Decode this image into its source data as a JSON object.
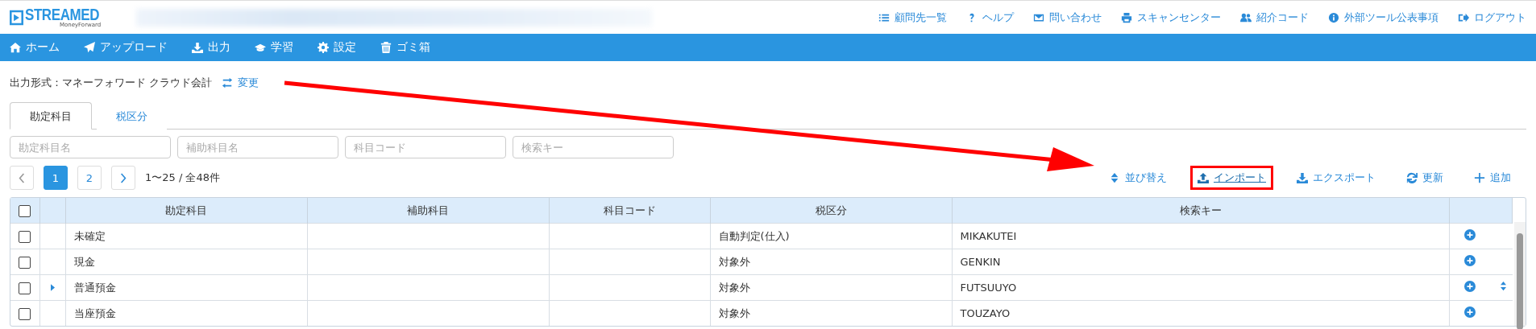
{
  "header": {
    "logo": {
      "name": "STREAMED",
      "tagline": "MoneyForward"
    },
    "links": [
      {
        "kind": "list",
        "label": "顧問先一覧"
      },
      {
        "kind": "help",
        "label": "ヘルプ"
      },
      {
        "kind": "mail",
        "label": "問い合わせ"
      },
      {
        "kind": "printer",
        "label": "スキャンセンター"
      },
      {
        "kind": "users",
        "label": "紹介コード"
      },
      {
        "kind": "info",
        "label": "外部ツール公表事項"
      },
      {
        "kind": "logout",
        "label": "ログアウト"
      }
    ]
  },
  "nav": [
    {
      "kind": "home",
      "label": "ホーム"
    },
    {
      "kind": "send",
      "label": "アップロード"
    },
    {
      "kind": "download",
      "label": "出力"
    },
    {
      "kind": "cap",
      "label": "学習"
    },
    {
      "kind": "gear",
      "label": "設定"
    },
    {
      "kind": "trash",
      "label": "ゴミ箱"
    }
  ],
  "output_format": {
    "label": "出力形式：マネーフォワード クラウド会計",
    "change": "変更"
  },
  "tabs": [
    {
      "label": "勘定科目",
      "selected": true
    },
    {
      "label": "税区分",
      "selected": false
    }
  ],
  "filters": [
    {
      "placeholder": "勘定科目名"
    },
    {
      "placeholder": "補助科目名"
    },
    {
      "placeholder": "科目コード"
    },
    {
      "placeholder": "検索キー"
    }
  ],
  "pagination": {
    "pages": [
      {
        "label": "1",
        "selected": true
      },
      {
        "label": "2",
        "selected": false
      }
    ],
    "summary": "1〜25 / 全48件"
  },
  "toolbar": [
    {
      "kind": "sort",
      "label": "並び替え",
      "annotated": false
    },
    {
      "kind": "upload",
      "label": "インポート",
      "annotated": true
    },
    {
      "kind": "download",
      "label": "エクスポート",
      "annotated": false
    },
    {
      "kind": "refresh",
      "label": "更新",
      "annotated": false
    },
    {
      "kind": "plus",
      "label": "追加",
      "annotated": false
    }
  ],
  "table": {
    "select_all_checked": false,
    "columns": [
      "勘定科目",
      "補助科目",
      "科目コード",
      "税区分",
      "検索キー"
    ],
    "rows": [
      {
        "checked": false,
        "has_children": false,
        "movable": false,
        "cells": [
          "未確定",
          "",
          "",
          "自動判定(仕入)",
          "MIKAKUTEI"
        ]
      },
      {
        "checked": false,
        "has_children": false,
        "movable": false,
        "cells": [
          "現金",
          "",
          "",
          "対象外",
          "GENKIN"
        ]
      },
      {
        "checked": false,
        "has_children": true,
        "movable": true,
        "cells": [
          "普通預金",
          "",
          "",
          "対象外",
          "FUTSUUYO"
        ]
      },
      {
        "checked": false,
        "has_children": false,
        "movable": false,
        "cells": [
          "当座預金",
          "",
          "",
          "対象外",
          "TOUZAYO"
        ]
      }
    ]
  }
}
